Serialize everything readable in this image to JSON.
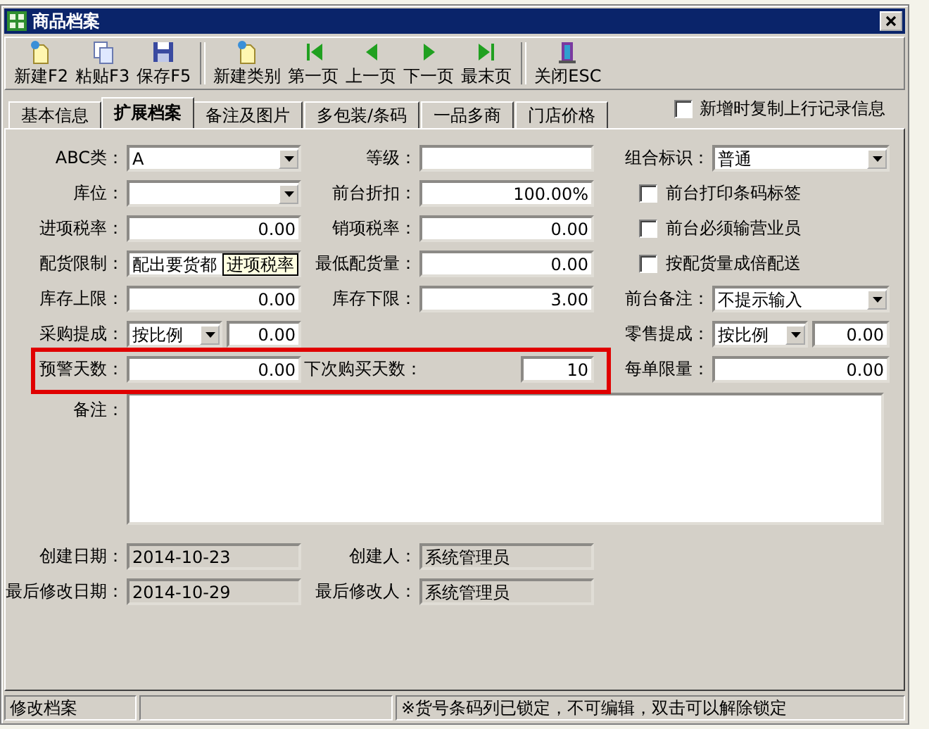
{
  "window": {
    "title": "商品档案"
  },
  "toolbar": {
    "groups": [
      [
        {
          "label": "新建F2"
        },
        {
          "label": "粘贴F3"
        },
        {
          "label": "保存F5"
        }
      ],
      [
        {
          "label": "新建类别"
        },
        {
          "label": "第一页"
        },
        {
          "label": "上一页"
        },
        {
          "label": "下一页"
        },
        {
          "label": "最末页"
        }
      ],
      [
        {
          "label": "关闭ESC"
        }
      ]
    ]
  },
  "tabs": [
    {
      "label": "基本信息",
      "selected": false
    },
    {
      "label": "扩展档案",
      "selected": true
    },
    {
      "label": "备注及图片",
      "selected": false
    },
    {
      "label": "多包装/条码",
      "selected": false
    },
    {
      "label": "一品多商",
      "selected": false
    },
    {
      "label": "门店价格",
      "selected": false
    }
  ],
  "copy_option": {
    "label": "新增时复制上行记录信息",
    "checked": false
  },
  "form": {
    "rows": [
      {
        "highlighted": false,
        "cells": [
          {
            "kind": "combo",
            "label": "ABC类：",
            "value": "A"
          },
          {
            "kind": "text",
            "label": "等级："
          },
          {
            "kind": "combo",
            "label": "组合标识：",
            "value": "普通"
          }
        ]
      },
      {
        "highlighted": false,
        "cells": [
          {
            "kind": "combo",
            "label": "库位："
          },
          {
            "kind": "text",
            "label": "前台折扣：",
            "value": "100.00%"
          },
          {
            "kind": "checkbox",
            "label": "前台打印条码标签",
            "checked": false
          }
        ]
      },
      {
        "highlighted": false,
        "cells": [
          {
            "kind": "text",
            "label": "进项税率：",
            "value": "0.00"
          },
          {
            "kind": "text",
            "label": "销项税率：",
            "value": "0.00"
          },
          {
            "kind": "checkbox",
            "label": "前台必须输营业员",
            "checked": false
          }
        ]
      },
      {
        "highlighted": false,
        "cells": [
          {
            "kind": "text",
            "label": "配货限制：",
            "value": "配出要货都",
            "tooltip": "进项税率"
          },
          {
            "kind": "text",
            "label": "最低配货量：",
            "value": "0.00"
          },
          {
            "kind": "checkbox",
            "label": "按配货量成倍配送",
            "checked": false
          }
        ]
      },
      {
        "highlighted": false,
        "cells": [
          {
            "kind": "text",
            "label": "库存上限：",
            "value": "0.00"
          },
          {
            "kind": "text",
            "label": "库存下限：",
            "value": "3.00"
          },
          {
            "kind": "combo",
            "label": "前台备注：",
            "value": "不提示输入"
          }
        ]
      },
      {
        "highlighted": false,
        "cells": [
          {
            "kind": "combo-text",
            "label": "采购提成：",
            "value": "按比例",
            "amount": "0.00"
          },
          {
            "kind": "empty"
          },
          {
            "kind": "combo-text",
            "label": "零售提成：",
            "value": "按比例",
            "amount": "0.00"
          }
        ]
      },
      {
        "highlighted": true,
        "cells": [
          {
            "kind": "text",
            "label": "预警天数：",
            "value": "0.00"
          },
          {
            "kind": "short-text",
            "label": "下次购买天数：",
            "value": "10"
          },
          {
            "kind": "text",
            "label": "每单限量：",
            "value": "0.00"
          }
        ]
      }
    ],
    "memo": {
      "label": "备注："
    },
    "audit_rows": [
      {
        "cells": [
          {
            "label": "创建日期：",
            "value": "2014-10-23"
          },
          {
            "label": "创建人：",
            "value": "系统管理员"
          }
        ]
      },
      {
        "cells": [
          {
            "label": "最后修改日期：",
            "value": "2014-10-29"
          },
          {
            "label": "最后修改人：",
            "value": "系统管理员"
          }
        ]
      }
    ]
  },
  "status_bar": {
    "left": "修改档案",
    "right": "※货号条码列已锁定，不可编辑，双击可以解除锁定"
  }
}
